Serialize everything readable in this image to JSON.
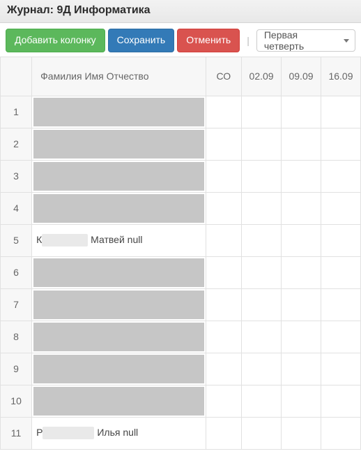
{
  "header": {
    "title_prefix": "Журнал:",
    "title_subject": "9Д Информатика"
  },
  "toolbar": {
    "add_column_label": "Добавить колонку",
    "save_label": "Сохранить",
    "cancel_label": "Отменить",
    "separator": "|",
    "period_selected": "Первая четверть"
  },
  "columns": {
    "name_header": "Фамилия Имя Отчество",
    "co_header": "СО",
    "dates": [
      "02.09",
      "09.09",
      "16.09"
    ]
  },
  "rows": [
    {
      "num": "1",
      "name_visible": "",
      "redact": "full"
    },
    {
      "num": "2",
      "name_visible": "",
      "redact": "full"
    },
    {
      "num": "3",
      "name_visible": "",
      "redact": "full"
    },
    {
      "num": "4",
      "name_visible": "",
      "redact": "full"
    },
    {
      "num": "5",
      "name_visible": "Матвей null",
      "redact": "partial",
      "prefix": "К",
      "gap_w": 66
    },
    {
      "num": "6",
      "name_visible": "",
      "redact": "full"
    },
    {
      "num": "7",
      "name_visible": "",
      "redact": "full"
    },
    {
      "num": "8",
      "name_visible": "",
      "redact": "full"
    },
    {
      "num": "9",
      "name_visible": "",
      "redact": "full"
    },
    {
      "num": "10",
      "name_visible": "",
      "redact": "full"
    },
    {
      "num": "11",
      "name_visible": "Илья null",
      "redact": "partial",
      "prefix": "Р",
      "gap_w": 74
    }
  ]
}
